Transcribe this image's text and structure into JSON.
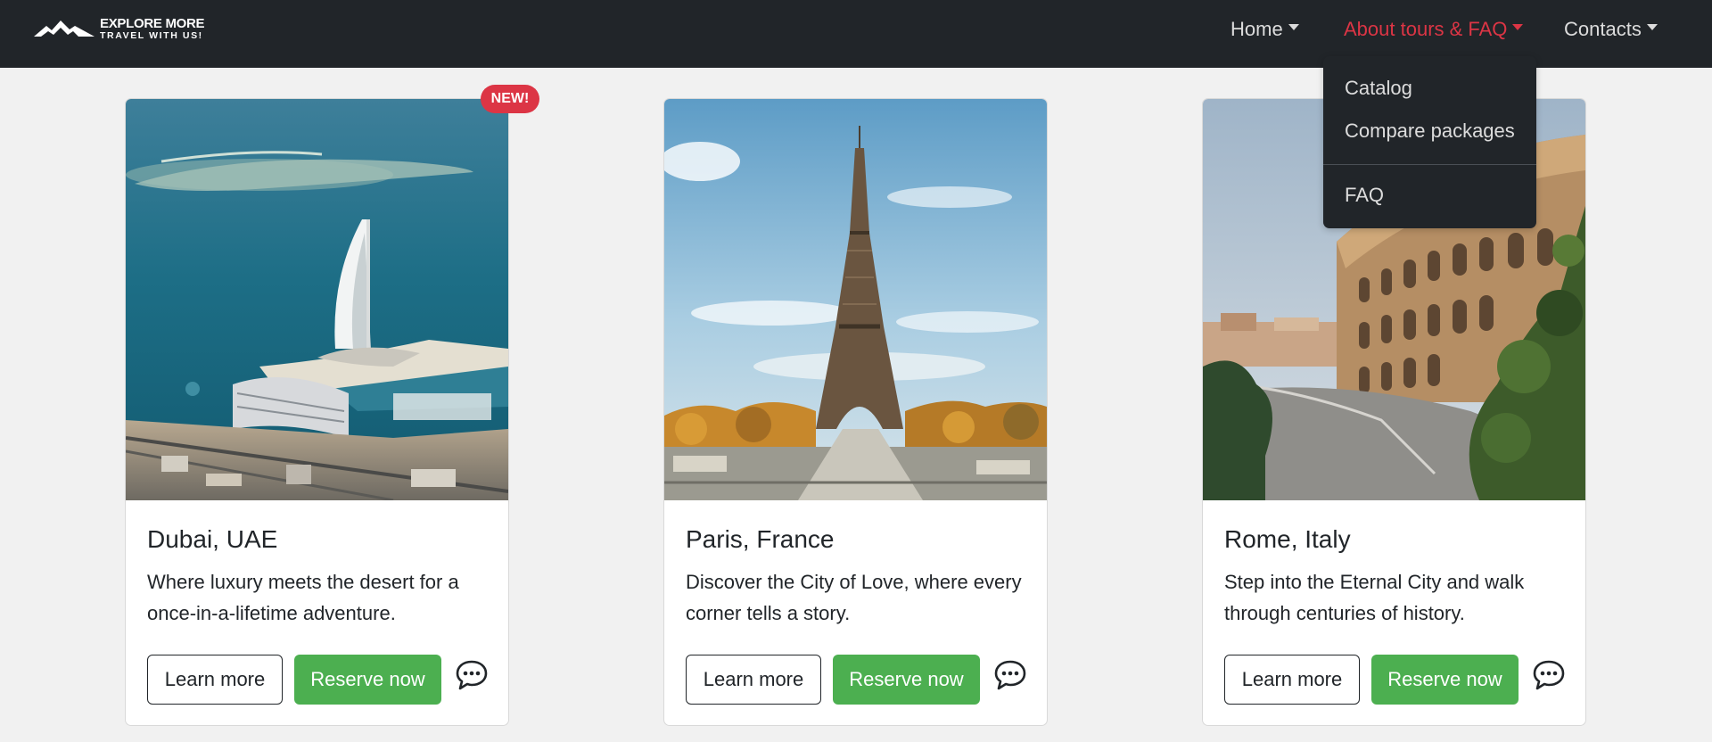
{
  "brand": {
    "line1": "EXPLORE MORE",
    "line2": "TRAVEL WITH US!",
    "icon": "mountains-icon"
  },
  "nav": {
    "home": "Home",
    "about": "About tours & FAQ",
    "contacts": "Contacts",
    "active": "about"
  },
  "dropdown": {
    "items": [
      "Catalog",
      "Compare packages",
      "FAQ"
    ]
  },
  "cards": [
    {
      "title": "Dubai, UAE",
      "text": "Where luxury meets the desert for a once-in-a-lifetime adventure.",
      "learn": "Learn more",
      "reserve": "Reserve now",
      "badge": "NEW!",
      "image": "dubai-burj-al-arab-photo"
    },
    {
      "title": "Paris, France",
      "text": "Discover the City of Love, where every corner tells a story.",
      "learn": "Learn more",
      "reserve": "Reserve now",
      "image": "paris-eiffel-tower-photo"
    },
    {
      "title": "Rome, Italy",
      "text": "Step into the Eternal City and walk through centuries of history.",
      "learn": "Learn more",
      "reserve": "Reserve now",
      "image": "rome-colosseum-photo"
    }
  ],
  "colors": {
    "navbar": "#212529",
    "active_nav": "#dc3545",
    "reserve_button": "#4caf50",
    "badge": "#dc3545",
    "page_bg": "#f1f1f1"
  }
}
